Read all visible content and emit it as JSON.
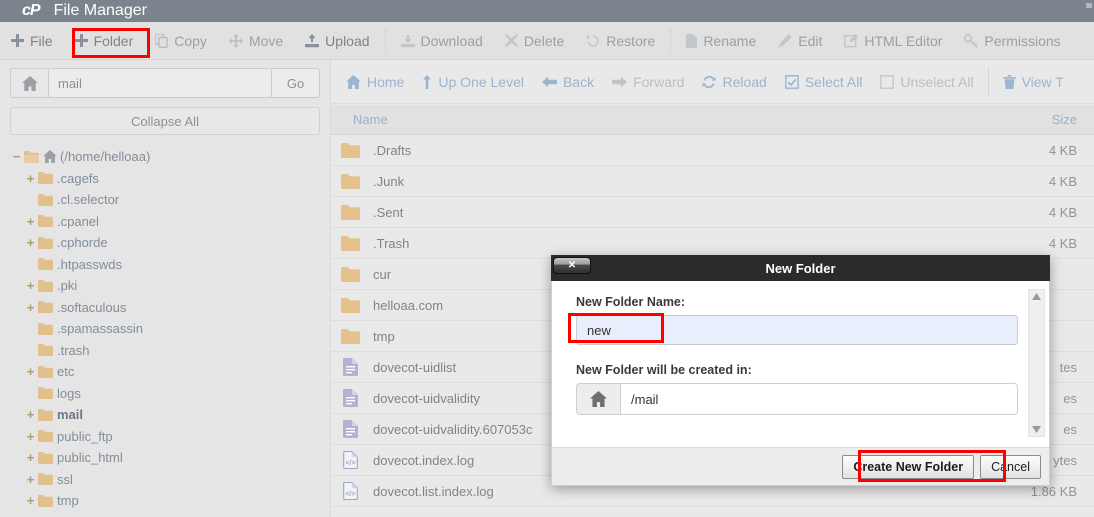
{
  "header": {
    "logo": "cP",
    "title": "File Manager"
  },
  "main_toolbar": {
    "buttons": [
      {
        "label": "File",
        "icon": "plus-icon",
        "enabled": true
      },
      {
        "label": "Folder",
        "icon": "plus-icon",
        "enabled": true
      },
      {
        "label": "Copy",
        "icon": "copy-icon",
        "enabled": false
      },
      {
        "label": "Move",
        "icon": "move-icon",
        "enabled": false
      },
      {
        "label": "Upload",
        "icon": "upload-icon",
        "enabled": true
      },
      {
        "label": "Download",
        "icon": "download-icon",
        "enabled": false
      },
      {
        "label": "Delete",
        "icon": "x-icon",
        "enabled": false
      },
      {
        "label": "Restore",
        "icon": "undo-icon",
        "enabled": false
      },
      {
        "label": "Rename",
        "icon": "file-icon",
        "enabled": false
      },
      {
        "label": "Edit",
        "icon": "pencil-icon",
        "enabled": false
      },
      {
        "label": "HTML Editor",
        "icon": "html-editor-icon",
        "enabled": false
      },
      {
        "label": "Permissions",
        "icon": "key-icon",
        "enabled": false
      }
    ]
  },
  "sidebar": {
    "path_value": "mail",
    "path_placeholder": "mail",
    "go_label": "Go",
    "collapse_all_label": "Collapse All",
    "home_icon": "home-icon",
    "tree": [
      {
        "label": "(/home/helloaa)",
        "indent": 0,
        "twisty": "−",
        "bold": false,
        "root": true
      },
      {
        "label": ".cagefs",
        "indent": 1,
        "twisty": "+",
        "bold": false
      },
      {
        "label": ".cl.selector",
        "indent": 1,
        "twisty": "",
        "bold": false
      },
      {
        "label": ".cpanel",
        "indent": 1,
        "twisty": "+",
        "bold": false
      },
      {
        "label": ".cphorde",
        "indent": 1,
        "twisty": "+",
        "bold": false
      },
      {
        "label": ".htpasswds",
        "indent": 1,
        "twisty": "",
        "bold": false
      },
      {
        "label": ".pki",
        "indent": 1,
        "twisty": "+",
        "bold": false
      },
      {
        "label": ".softaculous",
        "indent": 1,
        "twisty": "+",
        "bold": false
      },
      {
        "label": ".spamassassin",
        "indent": 1,
        "twisty": "",
        "bold": false
      },
      {
        "label": ".trash",
        "indent": 1,
        "twisty": "",
        "bold": false
      },
      {
        "label": "etc",
        "indent": 1,
        "twisty": "+",
        "bold": false
      },
      {
        "label": "logs",
        "indent": 1,
        "twisty": "",
        "bold": false
      },
      {
        "label": "mail",
        "indent": 1,
        "twisty": "+",
        "bold": true
      },
      {
        "label": "public_ftp",
        "indent": 1,
        "twisty": "+",
        "bold": false
      },
      {
        "label": "public_html",
        "indent": 1,
        "twisty": "+",
        "bold": false
      },
      {
        "label": "ssl",
        "indent": 1,
        "twisty": "+",
        "bold": false
      },
      {
        "label": "tmp",
        "indent": 1,
        "twisty": "+",
        "bold": false
      }
    ]
  },
  "file_toolbar": {
    "buttons": [
      {
        "label": "Home",
        "icon": "home-icon",
        "enabled": true
      },
      {
        "label": "Up One Level",
        "icon": "arrow-up-icon",
        "enabled": true
      },
      {
        "label": "Back",
        "icon": "arrow-left-icon",
        "enabled": true
      },
      {
        "label": "Forward",
        "icon": "arrow-right-icon",
        "enabled": false
      },
      {
        "label": "Reload",
        "icon": "reload-icon",
        "enabled": true
      },
      {
        "label": "Select All",
        "icon": "checkbox-checked-icon",
        "enabled": true
      },
      {
        "label": "Unselect All",
        "icon": "checkbox-empty-icon",
        "enabled": false
      },
      {
        "label": "View T",
        "icon": "trash-icon",
        "enabled": true
      }
    ]
  },
  "file_table": {
    "columns": {
      "name": "Name",
      "size": "Size"
    },
    "rows": [
      {
        "name": ".Drafts",
        "size": "4 KB",
        "icon": "folder-icon"
      },
      {
        "name": ".Junk",
        "size": "4 KB",
        "icon": "folder-icon"
      },
      {
        "name": ".Sent",
        "size": "4 KB",
        "icon": "folder-icon"
      },
      {
        "name": ".Trash",
        "size": "4 KB",
        "icon": "folder-icon"
      },
      {
        "name": "cur",
        "size": "",
        "icon": "folder-icon"
      },
      {
        "name": "helloaa.com",
        "size": "",
        "icon": "folder-icon"
      },
      {
        "name": "tmp",
        "size": "",
        "icon": "folder-icon"
      },
      {
        "name": "dovecot-uidlist",
        "size": "tes",
        "icon": "text-file-icon"
      },
      {
        "name": "dovecot-uidvalidity",
        "size": "es",
        "icon": "text-file-icon"
      },
      {
        "name": "dovecot-uidvalidity.607053c",
        "size": "es",
        "icon": "text-file-icon"
      },
      {
        "name": "dovecot.index.log",
        "size": "ytes",
        "icon": "code-file-icon"
      },
      {
        "name": "dovecot.list.index.log",
        "size": "1.86 KB",
        "icon": "code-file-icon"
      }
    ]
  },
  "modal": {
    "title": "New Folder",
    "close_label": "✕",
    "name_label": "New Folder Name:",
    "name_value": "new",
    "dest_label": "New Folder will be created in:",
    "dest_value": "/mail",
    "dest_home_icon": "home-icon",
    "create_label": "Create New Folder",
    "cancel_label": "Cancel",
    "scroll_up_icon": "triangle-up-icon",
    "scroll_down_icon": "triangle-down-icon"
  },
  "annotations": {
    "accent_color": "#fe0000",
    "boxes": [
      "folder-button",
      "new-folder-name-input",
      "create-new-folder-button"
    ]
  }
}
